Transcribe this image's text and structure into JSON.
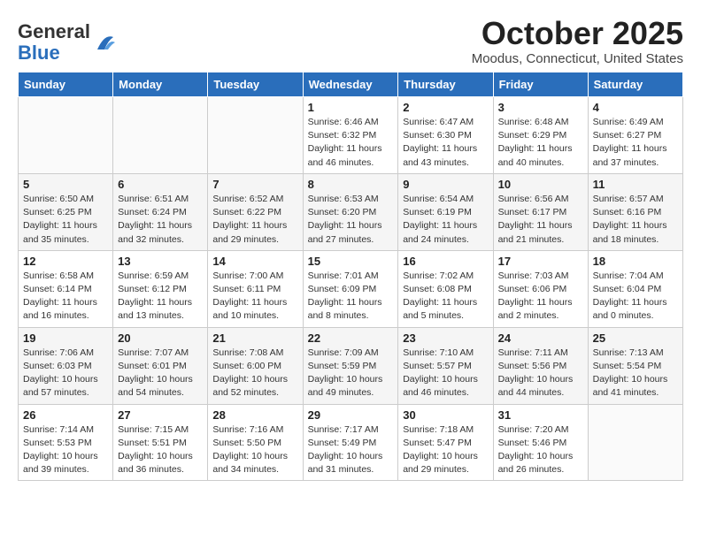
{
  "header": {
    "logo_general": "General",
    "logo_blue": "Blue",
    "month_title": "October 2025",
    "location": "Moodus, Connecticut, United States"
  },
  "days_of_week": [
    "Sunday",
    "Monday",
    "Tuesday",
    "Wednesday",
    "Thursday",
    "Friday",
    "Saturday"
  ],
  "weeks": [
    [
      {
        "day": "",
        "info": ""
      },
      {
        "day": "",
        "info": ""
      },
      {
        "day": "",
        "info": ""
      },
      {
        "day": "1",
        "info": "Sunrise: 6:46 AM\nSunset: 6:32 PM\nDaylight: 11 hours\nand 46 minutes."
      },
      {
        "day": "2",
        "info": "Sunrise: 6:47 AM\nSunset: 6:30 PM\nDaylight: 11 hours\nand 43 minutes."
      },
      {
        "day": "3",
        "info": "Sunrise: 6:48 AM\nSunset: 6:29 PM\nDaylight: 11 hours\nand 40 minutes."
      },
      {
        "day": "4",
        "info": "Sunrise: 6:49 AM\nSunset: 6:27 PM\nDaylight: 11 hours\nand 37 minutes."
      }
    ],
    [
      {
        "day": "5",
        "info": "Sunrise: 6:50 AM\nSunset: 6:25 PM\nDaylight: 11 hours\nand 35 minutes."
      },
      {
        "day": "6",
        "info": "Sunrise: 6:51 AM\nSunset: 6:24 PM\nDaylight: 11 hours\nand 32 minutes."
      },
      {
        "day": "7",
        "info": "Sunrise: 6:52 AM\nSunset: 6:22 PM\nDaylight: 11 hours\nand 29 minutes."
      },
      {
        "day": "8",
        "info": "Sunrise: 6:53 AM\nSunset: 6:20 PM\nDaylight: 11 hours\nand 27 minutes."
      },
      {
        "day": "9",
        "info": "Sunrise: 6:54 AM\nSunset: 6:19 PM\nDaylight: 11 hours\nand 24 minutes."
      },
      {
        "day": "10",
        "info": "Sunrise: 6:56 AM\nSunset: 6:17 PM\nDaylight: 11 hours\nand 21 minutes."
      },
      {
        "day": "11",
        "info": "Sunrise: 6:57 AM\nSunset: 6:16 PM\nDaylight: 11 hours\nand 18 minutes."
      }
    ],
    [
      {
        "day": "12",
        "info": "Sunrise: 6:58 AM\nSunset: 6:14 PM\nDaylight: 11 hours\nand 16 minutes."
      },
      {
        "day": "13",
        "info": "Sunrise: 6:59 AM\nSunset: 6:12 PM\nDaylight: 11 hours\nand 13 minutes."
      },
      {
        "day": "14",
        "info": "Sunrise: 7:00 AM\nSunset: 6:11 PM\nDaylight: 11 hours\nand 10 minutes."
      },
      {
        "day": "15",
        "info": "Sunrise: 7:01 AM\nSunset: 6:09 PM\nDaylight: 11 hours\nand 8 minutes."
      },
      {
        "day": "16",
        "info": "Sunrise: 7:02 AM\nSunset: 6:08 PM\nDaylight: 11 hours\nand 5 minutes."
      },
      {
        "day": "17",
        "info": "Sunrise: 7:03 AM\nSunset: 6:06 PM\nDaylight: 11 hours\nand 2 minutes."
      },
      {
        "day": "18",
        "info": "Sunrise: 7:04 AM\nSunset: 6:04 PM\nDaylight: 11 hours\nand 0 minutes."
      }
    ],
    [
      {
        "day": "19",
        "info": "Sunrise: 7:06 AM\nSunset: 6:03 PM\nDaylight: 10 hours\nand 57 minutes."
      },
      {
        "day": "20",
        "info": "Sunrise: 7:07 AM\nSunset: 6:01 PM\nDaylight: 10 hours\nand 54 minutes."
      },
      {
        "day": "21",
        "info": "Sunrise: 7:08 AM\nSunset: 6:00 PM\nDaylight: 10 hours\nand 52 minutes."
      },
      {
        "day": "22",
        "info": "Sunrise: 7:09 AM\nSunset: 5:59 PM\nDaylight: 10 hours\nand 49 minutes."
      },
      {
        "day": "23",
        "info": "Sunrise: 7:10 AM\nSunset: 5:57 PM\nDaylight: 10 hours\nand 46 minutes."
      },
      {
        "day": "24",
        "info": "Sunrise: 7:11 AM\nSunset: 5:56 PM\nDaylight: 10 hours\nand 44 minutes."
      },
      {
        "day": "25",
        "info": "Sunrise: 7:13 AM\nSunset: 5:54 PM\nDaylight: 10 hours\nand 41 minutes."
      }
    ],
    [
      {
        "day": "26",
        "info": "Sunrise: 7:14 AM\nSunset: 5:53 PM\nDaylight: 10 hours\nand 39 minutes."
      },
      {
        "day": "27",
        "info": "Sunrise: 7:15 AM\nSunset: 5:51 PM\nDaylight: 10 hours\nand 36 minutes."
      },
      {
        "day": "28",
        "info": "Sunrise: 7:16 AM\nSunset: 5:50 PM\nDaylight: 10 hours\nand 34 minutes."
      },
      {
        "day": "29",
        "info": "Sunrise: 7:17 AM\nSunset: 5:49 PM\nDaylight: 10 hours\nand 31 minutes."
      },
      {
        "day": "30",
        "info": "Sunrise: 7:18 AM\nSunset: 5:47 PM\nDaylight: 10 hours\nand 29 minutes."
      },
      {
        "day": "31",
        "info": "Sunrise: 7:20 AM\nSunset: 5:46 PM\nDaylight: 10 hours\nand 26 minutes."
      },
      {
        "day": "",
        "info": ""
      }
    ]
  ]
}
